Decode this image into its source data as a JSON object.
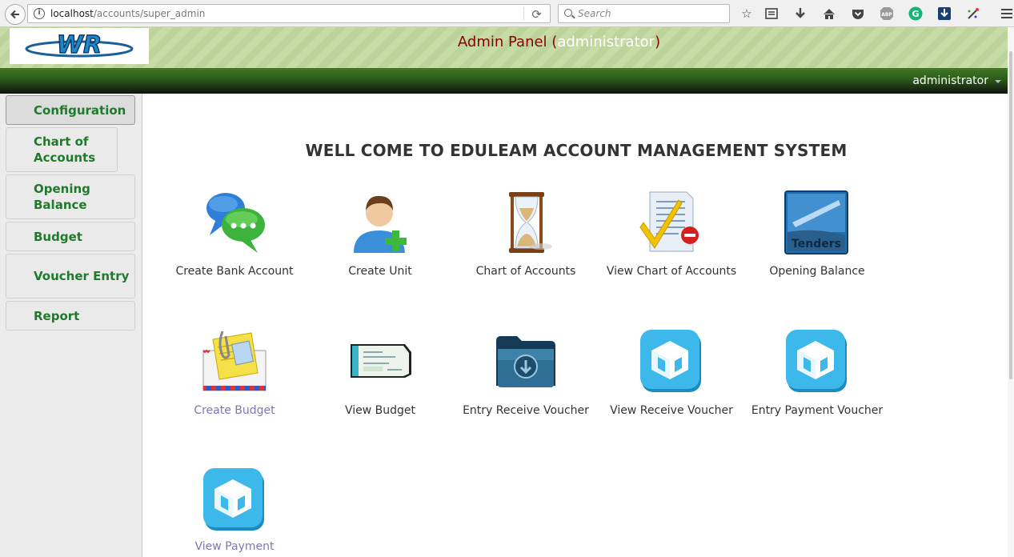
{
  "browser": {
    "url_host": "localhost",
    "url_path": "/accounts/super_admin",
    "search_placeholder": "Search",
    "toolbar_icons": [
      "star-icon",
      "reading-list-icon",
      "download-icon",
      "home-icon",
      "pocket-icon",
      "adblock-icon",
      "grammarly-icon",
      "save-icon",
      "extension-icon",
      "menu-icon"
    ]
  },
  "header": {
    "title": "Admin Panel",
    "user": "administrator",
    "logo_text": "WR",
    "user_menu": "administrator"
  },
  "sidebar": {
    "items": [
      {
        "label": "Configuration",
        "active": true
      },
      {
        "label": "Chart of Accounts",
        "active": false
      },
      {
        "label": "Opening Balance",
        "active": false
      },
      {
        "label": "Budget",
        "active": false
      },
      {
        "label": "Voucher Entry",
        "active": false
      },
      {
        "label": "Report",
        "active": false
      }
    ]
  },
  "main": {
    "welcome": "WELL COME TO EDULEAM ACCOUNT MANAGEMENT SYSTEM",
    "tiles": [
      {
        "label": "Create Bank Account",
        "icon": "chat-bubbles-icon"
      },
      {
        "label": "Create Unit",
        "icon": "add-user-icon"
      },
      {
        "label": "Chart of Accounts",
        "icon": "hourglass-icon"
      },
      {
        "label": "View Chart of Accounts",
        "icon": "checklist-icon"
      },
      {
        "label": "Opening Balance",
        "icon": "tenders-icon",
        "icon_text": "Tenders"
      },
      {
        "label": "Create Budget",
        "icon": "mail-notes-icon",
        "link": true
      },
      {
        "label": "View Budget",
        "icon": "cheque-icon"
      },
      {
        "label": "Entry Receive Voucher",
        "icon": "folder-download-icon"
      },
      {
        "label": "View Receive Voucher",
        "icon": "box-app-icon"
      },
      {
        "label": "Entry Payment Voucher",
        "icon": "box-app-icon"
      },
      {
        "label": "View Payment",
        "icon": "box-app-icon",
        "link": true
      }
    ]
  },
  "colors": {
    "sidebar_text": "#1f7a2a",
    "title_red": "#8b0000",
    "header_green": "#c6dba6",
    "link_purple": "#7a78b4"
  }
}
